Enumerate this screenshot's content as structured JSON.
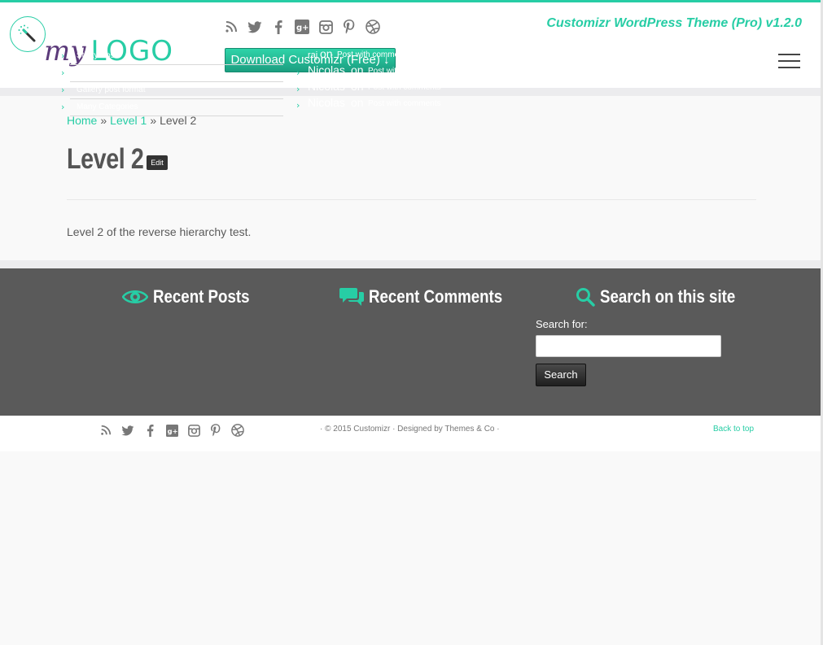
{
  "header": {
    "logo_my": "my",
    "logo_word": "LOGO",
    "download_label": "Download Customizr (Free) ↓",
    "tagline": "Customizr WordPress Theme (Pro) v1.2.0"
  },
  "social_icons": [
    "rss-icon",
    "twitter-icon",
    "facebook-icon",
    "google-plus-icon",
    "instagram-icon",
    "pinterest-icon",
    "dribbble-icon"
  ],
  "breadcrumb": {
    "home": "Home",
    "level1": "Level 1",
    "sep": "»",
    "current": "Level 2"
  },
  "page": {
    "title": "Level 2",
    "edit_label": "Edit",
    "content": "Level 2 of the reverse hierarchy test."
  },
  "widgets": {
    "recent_posts": {
      "title": "Recent Posts",
      "items": [
        "Sticky Post",
        "Layout and typography",
        "Gallery post format",
        "Many Categories"
      ]
    },
    "recent_comments": {
      "title": "Recent Comments",
      "on_word": "on",
      "items": [
        {
          "author": "raj",
          "post": "Post with comments"
        },
        {
          "author": "Nicolas",
          "post": "Post with comments"
        },
        {
          "author": "Nicolas",
          "post": "Post with comments"
        },
        {
          "author": "Nicolas",
          "post": "Post with comments"
        }
      ]
    },
    "search": {
      "title": "Search on this site",
      "label": "Search for:",
      "button": "Search",
      "value": ""
    }
  },
  "footer": {
    "credits": "· © 2015 Customizr · Designed by Themes & Co ·",
    "back_to_top": "Back to top"
  },
  "colors": {
    "accent": "#27cda5",
    "footer_bg": "#5a5a5a",
    "logo_purple": "#5b3a7a"
  }
}
